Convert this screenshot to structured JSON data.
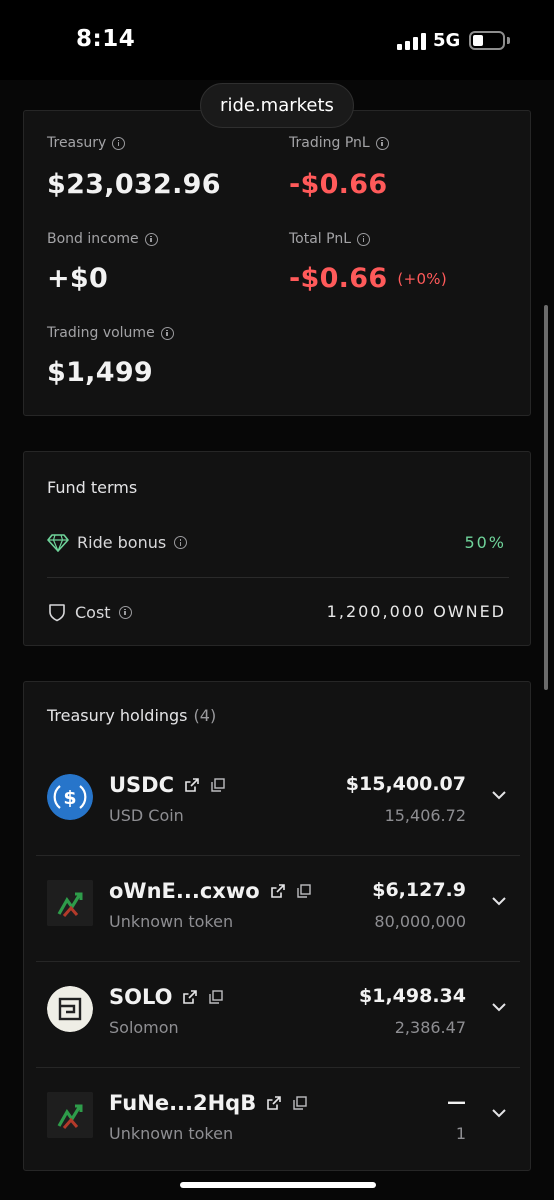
{
  "status_bar": {
    "time": "8:14",
    "network": "5G",
    "battery_fraction": 0.35
  },
  "browser": {
    "url": "ride.markets"
  },
  "stats": {
    "treasury_label": "Treasury",
    "treasury_value": "$23,032.96",
    "trading_pnl_label": "Trading PnL",
    "trading_pnl_value": "-$0.66",
    "bond_income_label": "Bond income",
    "bond_income_value": "+$0",
    "total_pnl_label": "Total PnL",
    "total_pnl_value": "-$0.66",
    "total_pnl_pct": "(+0%)",
    "trading_volume_label": "Trading volume",
    "trading_volume_value": "$1,499"
  },
  "fund_terms": {
    "title": "Fund terms",
    "ride_bonus_label": "Ride bonus",
    "ride_bonus_value": "50%",
    "cost_label": "Cost",
    "cost_value": "1,200,000 OWNED"
  },
  "holdings": {
    "title": "Treasury holdings",
    "count": "(4)",
    "items": [
      {
        "symbol": "USDC",
        "name": "USD Coin",
        "value": "$15,400.07",
        "amount": "15,406.72",
        "icon": "usdc-logo"
      },
      {
        "symbol": "oWnE...cxwo",
        "name": "Unknown token",
        "value": "$6,127.9",
        "amount": "80,000,000",
        "icon": "unknown-token-logo"
      },
      {
        "symbol": "SOLO",
        "name": "Solomon",
        "value": "$1,498.34",
        "amount": "2,386.47",
        "icon": "solomon-logo"
      },
      {
        "symbol": "FuNe...2HqB",
        "name": "Unknown token",
        "value": "—",
        "amount": "1",
        "icon": "unknown-token-logo"
      }
    ]
  },
  "colors": {
    "negative": "#ff5a5a",
    "positive": "#6fd39a",
    "usdc_blue": "#2775ca"
  }
}
